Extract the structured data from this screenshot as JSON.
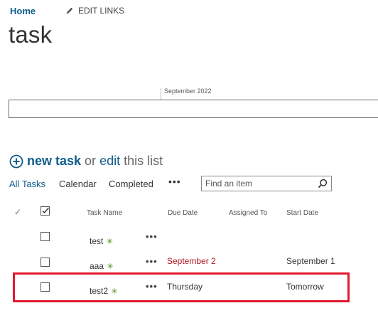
{
  "nav": {
    "home": "Home",
    "edit_links": "EDIT LINKS"
  },
  "page": {
    "title": "task"
  },
  "timeline": {
    "month": "September 2022"
  },
  "new_task": {
    "new_label": "new task",
    "or": "or",
    "edit": "edit",
    "this_list": "this list"
  },
  "views": {
    "all": "All Tasks",
    "calendar": "Calendar",
    "completed": "Completed",
    "more": "•••"
  },
  "search": {
    "placeholder": "Find an item"
  },
  "columns": {
    "check": "✓",
    "name": "Task Name",
    "due": "Due Date",
    "assigned": "Assigned To",
    "start": "Start Date"
  },
  "rows": [
    {
      "name": "test",
      "new": "✳",
      "menu": "•••",
      "due": "",
      "assigned": "",
      "start": ""
    },
    {
      "name": "aaa",
      "new": "✳",
      "menu": "•••",
      "due": "September 2",
      "assigned": "",
      "start": "September 1"
    },
    {
      "name": "test2",
      "new": "✳",
      "menu": "•••",
      "due": "Thursday",
      "assigned": "",
      "start": "Tomorrow"
    }
  ],
  "colors": {
    "link": "#0f5c8c",
    "overdue": "#b0131d",
    "highlight": "#e3182d",
    "new_badge": "#4b8a18"
  },
  "icons": {
    "edit": "pencil-icon",
    "new": "plus-circle-icon",
    "search": "search-icon",
    "select_all": "checkmark-box-icon"
  }
}
